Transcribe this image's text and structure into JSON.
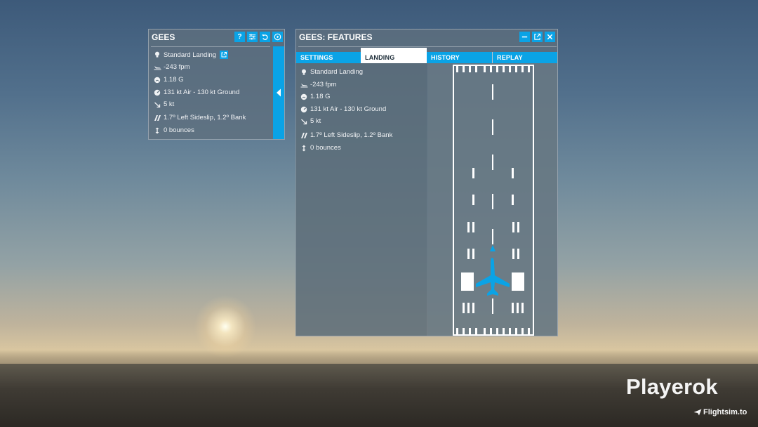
{
  "small_panel": {
    "title": "GEES",
    "buttons": [
      "help",
      "settings",
      "reset",
      "play"
    ],
    "help_label": "?",
    "stats": [
      {
        "icon": "bulb-icon",
        "text": "Standard Landing"
      },
      {
        "icon": "landing-plane-icon",
        "text": "-243 fpm"
      },
      {
        "icon": "gauge-icon",
        "text": "1.18 G"
      },
      {
        "icon": "speed-icon",
        "text": "131 kt Air - 130 kt Ground"
      },
      {
        "icon": "wind-arrow-icon",
        "text": "5 kt"
      },
      {
        "icon": "sideslip-icon",
        "text": "1.7º Left Sideslip, 1.2º Bank"
      },
      {
        "icon": "bounce-icon",
        "text": "0 bounces"
      }
    ]
  },
  "features_panel": {
    "title": "GEES: FEATURES",
    "tabs": [
      {
        "label": "SETTINGS",
        "active": false
      },
      {
        "label": "LANDING",
        "active": true
      },
      {
        "label": "HISTORY",
        "active": false
      },
      {
        "label": "REPLAY",
        "active": false
      }
    ],
    "stats": [
      {
        "icon": "bulb-icon",
        "text": "Standard Landing"
      },
      {
        "icon": "landing-plane-icon",
        "text": "-243 fpm"
      },
      {
        "icon": "gauge-icon",
        "text": "1.18 G"
      },
      {
        "icon": "speed-icon",
        "text": "131 kt Air - 130 kt Ground"
      },
      {
        "icon": "wind-arrow-icon",
        "text": "5 kt"
      },
      {
        "icon": "sideslip-icon",
        "text": "1.7º Left Sideslip, 1.2º Bank"
      },
      {
        "icon": "bounce-icon",
        "text": "0 bounces"
      }
    ]
  },
  "watermark": {
    "brand": "Playerok",
    "site": "Flightsim.to"
  },
  "colors": {
    "accent": "#0aa3e6",
    "panel": "#5f707d",
    "text": "#f0f2f4"
  }
}
